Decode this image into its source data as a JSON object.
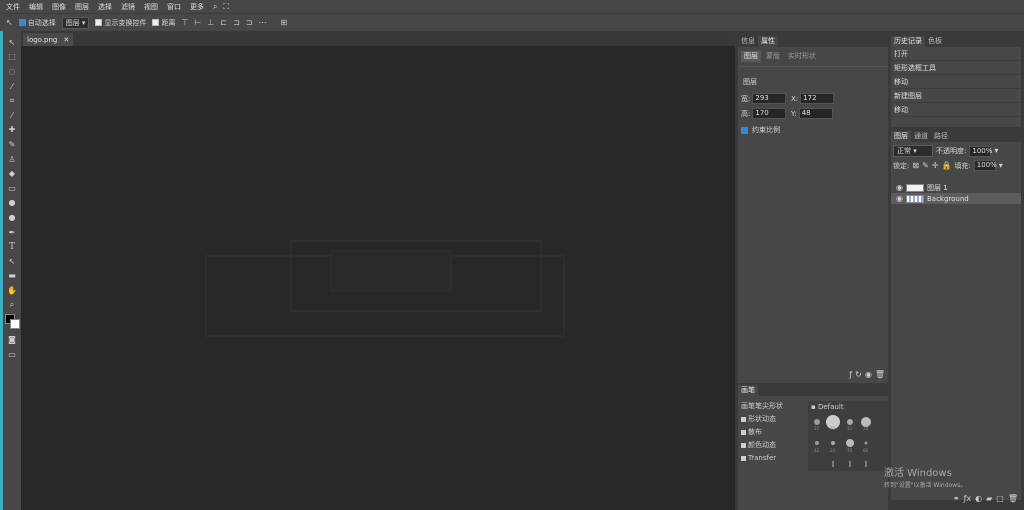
{
  "menu": [
    "文件",
    "编辑",
    "图像",
    "图层",
    "选择",
    "滤镜",
    "视图",
    "窗口",
    "更多"
  ],
  "options": {
    "auto_select": "自动选择",
    "layer_select": "图层",
    "show_transform": "显示变换控件",
    "distance": "距离"
  },
  "document": {
    "tab_name": "logo.png",
    "close": "✕"
  },
  "props_panel": {
    "tabs": [
      "信息",
      "属性"
    ],
    "subtabs": [
      "图层",
      "蒙版",
      "实时形状"
    ],
    "section": "图层",
    "w_label": "宽:",
    "w_value": "293",
    "h_label": "高:",
    "h_value": "170",
    "x_label": "X:",
    "x_value": "172",
    "y_label": "Y:",
    "y_value": "48",
    "constrain": "约束比例"
  },
  "history_panel": {
    "tabs": [
      "历史记录",
      "色板"
    ],
    "items": [
      "打开",
      "矩形选框工具",
      "移动",
      "新建图层",
      "移动"
    ]
  },
  "layers_panel": {
    "tabs": [
      "图层",
      "通道",
      "路径"
    ],
    "blend": "正常",
    "opacity_label": "不透明度:",
    "opacity_value": "100%",
    "lock_label": "锁定:",
    "fill_label": "填充:",
    "fill_value": "100%",
    "layers": [
      "图层 1",
      "Background"
    ]
  },
  "brush_panel": {
    "tab": "画笔",
    "title": "画笔笔尖形状",
    "options": [
      "形状动态",
      "散布",
      "颜色动态",
      "Transfer"
    ],
    "preset_folder": "Default",
    "sizes": [
      "10",
      "32",
      "32",
      "24",
      "42",
      "24",
      "70",
      "60"
    ]
  },
  "watermark": {
    "line1": "激活 Windows",
    "line2": "转到\"设置\"以激活 Windows。"
  },
  "colors": {
    "accent": "#3ab0c4",
    "canvas": "#282828",
    "panel": "#474747",
    "highlight": "#3a86d8"
  }
}
